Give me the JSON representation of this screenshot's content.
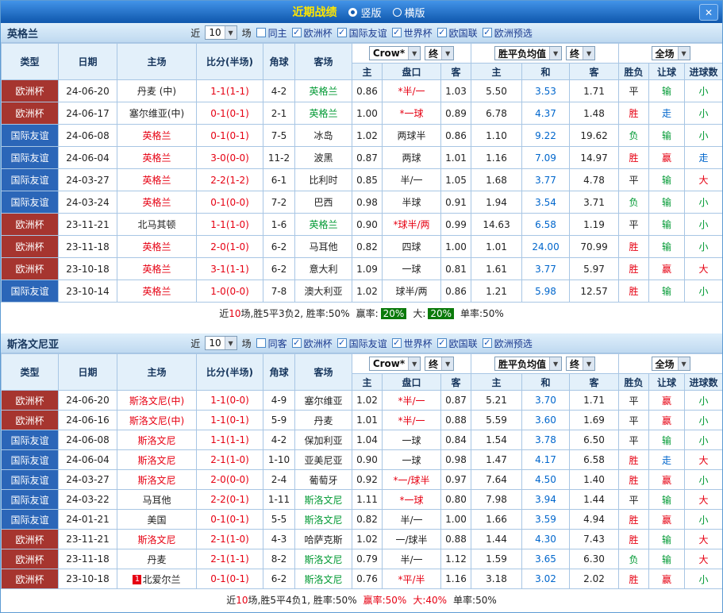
{
  "titlebar": {
    "title": "近期战绩",
    "radios": [
      {
        "label": "竖版",
        "selected": true
      },
      {
        "label": "横版",
        "selected": false
      }
    ]
  },
  "icons": {
    "close": "✕",
    "check": "✓",
    "chevron_down": "▼"
  },
  "colors": {
    "cup_bg": "#A6352F",
    "friendly_bg": "#2B66B8",
    "red_text": "#E60012",
    "green_text": "#009933",
    "blue_text": "#0066CC",
    "badge_green": "#0B7A0B"
  },
  "table_headers": {
    "left": [
      "类型",
      "日期",
      "主场",
      "比分(半场)",
      "角球",
      "客场"
    ],
    "sub": [
      "主",
      "盘口",
      "客",
      "主",
      "和",
      "客",
      "胜负",
      "让球",
      "进球数"
    ]
  },
  "sections": [
    {
      "team": "英格兰",
      "recent": {
        "pre": "近",
        "value": "10",
        "post": "场"
      },
      "checkboxes": [
        {
          "label": "同主",
          "checked": false
        },
        {
          "label": "欧洲杯",
          "checked": true
        },
        {
          "label": "国际友谊",
          "checked": true
        },
        {
          "label": "世界杯",
          "checked": true
        },
        {
          "label": "欧国联",
          "checked": true
        },
        {
          "label": "欧洲预选",
          "checked": true
        }
      ],
      "select_groups": [
        [
          "Crow*",
          "终"
        ],
        [
          "胜平负均值",
          "终"
        ],
        [
          "全场"
        ]
      ],
      "rows": [
        {
          "type": "欧洲杯",
          "date": "24-06-20",
          "home": "丹麦 (中)",
          "score": "1-1(1-1)",
          "corner": "4-2",
          "away": "英格兰",
          "hl": "away",
          "w1": "0.86",
          "hcp": "*半/一",
          "w2": "1.03",
          "e1": "5.50",
          "e2": "3.53",
          "e3": "1.71",
          "r1": "平",
          "r2": "输",
          "r3": "小"
        },
        {
          "type": "欧洲杯",
          "date": "24-06-17",
          "home": "塞尔维亚(中)",
          "score": "0-1(0-1)",
          "corner": "2-1",
          "away": "英格兰",
          "hl": "away",
          "w1": "1.00",
          "hcp": "*一球",
          "w2": "0.89",
          "e1": "6.78",
          "e2": "4.37",
          "e3": "1.48",
          "r1": "胜",
          "r2": "走",
          "r3": "小"
        },
        {
          "type": "国际友谊",
          "date": "24-06-08",
          "home": "英格兰",
          "score": "0-1(0-1)",
          "corner": "7-5",
          "away": "冰岛",
          "hl": "home",
          "w1": "1.02",
          "hcp": "两球半",
          "w2": "0.86",
          "e1": "1.10",
          "e2": "9.22",
          "e3": "19.62",
          "r1": "负",
          "r2": "输",
          "r3": "小"
        },
        {
          "type": "国际友谊",
          "date": "24-06-04",
          "home": "英格兰",
          "score": "3-0(0-0)",
          "corner": "11-2",
          "away": "波黑",
          "hl": "home",
          "w1": "0.87",
          "hcp": "两球",
          "w2": "1.01",
          "e1": "1.16",
          "e2": "7.09",
          "e3": "14.97",
          "r1": "胜",
          "r2": "赢",
          "r3": "走"
        },
        {
          "type": "国际友谊",
          "date": "24-03-27",
          "home": "英格兰",
          "score": "2-2(1-2)",
          "corner": "6-1",
          "away": "比利时",
          "hl": "home",
          "w1": "0.85",
          "hcp": "半/一",
          "w2": "1.05",
          "e1": "1.68",
          "e2": "3.77",
          "e3": "4.78",
          "r1": "平",
          "r2": "输",
          "r3": "大"
        },
        {
          "type": "国际友谊",
          "date": "24-03-24",
          "home": "英格兰",
          "score": "0-1(0-0)",
          "corner": "7-2",
          "away": "巴西",
          "hl": "home",
          "w1": "0.98",
          "hcp": "半球",
          "w2": "0.91",
          "e1": "1.94",
          "e2": "3.54",
          "e3": "3.71",
          "r1": "负",
          "r2": "输",
          "r3": "小"
        },
        {
          "type": "欧洲杯",
          "date": "23-11-21",
          "home": "北马其顿",
          "score": "1-1(1-0)",
          "corner": "1-6",
          "away": "英格兰",
          "hl": "away",
          "w1": "0.90",
          "hcp": "*球半/两",
          "w2": "0.99",
          "e1": "14.63",
          "e2": "6.58",
          "e3": "1.19",
          "r1": "平",
          "r2": "输",
          "r3": "小"
        },
        {
          "type": "欧洲杯",
          "date": "23-11-18",
          "home": "英格兰",
          "score": "2-0(1-0)",
          "corner": "6-2",
          "away": "马耳他",
          "hl": "home",
          "w1": "0.82",
          "hcp": "四球",
          "w2": "1.00",
          "e1": "1.01",
          "e2": "24.00",
          "e3": "70.99",
          "r1": "胜",
          "r2": "输",
          "r3": "小"
        },
        {
          "type": "欧洲杯",
          "date": "23-10-18",
          "home": "英格兰",
          "score": "3-1(1-1)",
          "corner": "6-2",
          "away": "意大利",
          "hl": "home",
          "w1": "1.09",
          "hcp": "一球",
          "w2": "0.81",
          "e1": "1.61",
          "e2": "3.77",
          "e3": "5.97",
          "r1": "胜",
          "r2": "赢",
          "r3": "大"
        },
        {
          "type": "国际友谊",
          "date": "23-10-14",
          "home": "英格兰",
          "score": "1-0(0-0)",
          "corner": "7-8",
          "away": "澳大利亚",
          "hl": "home",
          "w1": "1.02",
          "hcp": "球半/两",
          "w2": "0.86",
          "e1": "1.21",
          "e2": "5.98",
          "e3": "12.57",
          "r1": "胜",
          "r2": "输",
          "r3": "小"
        }
      ],
      "summary_runs": [
        {
          "t": "近"
        },
        {
          "t": "10",
          "s": "red"
        },
        {
          "t": "场,胜5平3负2, 胜率:50%"
        },
        {
          "t": "赢率:",
          "s": "sp"
        },
        {
          "t": "20%",
          "s": "badge"
        },
        {
          "t": "大:",
          "s": "sp"
        },
        {
          "t": "20%",
          "s": "badge"
        },
        {
          "t": "单率:50%",
          "s": "sp"
        }
      ]
    },
    {
      "team": "斯洛文尼亚",
      "recent": {
        "pre": "近",
        "value": "10",
        "post": "场"
      },
      "checkboxes": [
        {
          "label": "同客",
          "checked": false
        },
        {
          "label": "欧洲杯",
          "checked": true
        },
        {
          "label": "国际友谊",
          "checked": true
        },
        {
          "label": "世界杯",
          "checked": true
        },
        {
          "label": "欧国联",
          "checked": true
        },
        {
          "label": "欧洲预选",
          "checked": true
        }
      ],
      "select_groups": [
        [
          "Crow*",
          "终"
        ],
        [
          "胜平负均值",
          "终"
        ],
        [
          "全场"
        ]
      ],
      "rows": [
        {
          "type": "欧洲杯",
          "date": "24-06-20",
          "home": "斯洛文尼(中)",
          "score": "1-1(0-0)",
          "corner": "4-9",
          "away": "塞尔维亚",
          "hl": "home",
          "w1": "1.02",
          "hcp": "*半/一",
          "w2": "0.87",
          "e1": "5.21",
          "e2": "3.70",
          "e3": "1.71",
          "r1": "平",
          "r2": "赢",
          "r3": "小"
        },
        {
          "type": "欧洲杯",
          "date": "24-06-16",
          "home": "斯洛文尼(中)",
          "score": "1-1(0-1)",
          "corner": "5-9",
          "away": "丹麦",
          "hl": "home",
          "w1": "1.01",
          "hcp": "*半/一",
          "w2": "0.88",
          "e1": "5.59",
          "e2": "3.60",
          "e3": "1.69",
          "r1": "平",
          "r2": "赢",
          "r3": "小"
        },
        {
          "type": "国际友谊",
          "date": "24-06-08",
          "home": "斯洛文尼",
          "score": "1-1(1-1)",
          "corner": "4-2",
          "away": "保加利亚",
          "hl": "home",
          "w1": "1.04",
          "hcp": "一球",
          "w2": "0.84",
          "e1": "1.54",
          "e2": "3.78",
          "e3": "6.50",
          "r1": "平",
          "r2": "输",
          "r3": "小"
        },
        {
          "type": "国际友谊",
          "date": "24-06-04",
          "home": "斯洛文尼",
          "score": "2-1(1-0)",
          "corner": "1-10",
          "away": "亚美尼亚",
          "hl": "home",
          "w1": "0.90",
          "hcp": "一球",
          "w2": "0.98",
          "e1": "1.47",
          "e2": "4.17",
          "e3": "6.58",
          "r1": "胜",
          "r2": "走",
          "r3": "大"
        },
        {
          "type": "国际友谊",
          "date": "24-03-27",
          "home": "斯洛文尼",
          "score": "2-0(0-0)",
          "corner": "2-4",
          "away": "葡萄牙",
          "hl": "home",
          "w1": "0.92",
          "hcp": "*一/球半",
          "w2": "0.97",
          "e1": "7.64",
          "e2": "4.50",
          "e3": "1.40",
          "r1": "胜",
          "r2": "赢",
          "r3": "小"
        },
        {
          "type": "国际友谊",
          "date": "24-03-22",
          "home": "马耳他",
          "score": "2-2(0-1)",
          "corner": "1-11",
          "away": "斯洛文尼",
          "hl": "away",
          "w1": "1.11",
          "hcp": "*一球",
          "w2": "0.80",
          "e1": "7.98",
          "e2": "3.94",
          "e3": "1.44",
          "r1": "平",
          "r2": "输",
          "r3": "大"
        },
        {
          "type": "国际友谊",
          "date": "24-01-21",
          "home": "美国",
          "score": "0-1(0-1)",
          "corner": "5-5",
          "away": "斯洛文尼",
          "hl": "away",
          "w1": "0.82",
          "hcp": "半/一",
          "w2": "1.00",
          "e1": "1.66",
          "e2": "3.59",
          "e3": "4.94",
          "r1": "胜",
          "r2": "赢",
          "r3": "小"
        },
        {
          "type": "欧洲杯",
          "date": "23-11-21",
          "home": "斯洛文尼",
          "score": "2-1(1-0)",
          "corner": "4-3",
          "away": "哈萨克斯",
          "hl": "home",
          "w1": "1.02",
          "hcp": "一/球半",
          "w2": "0.88",
          "e1": "1.44",
          "e2": "4.30",
          "e3": "7.43",
          "r1": "胜",
          "r2": "输",
          "r3": "大"
        },
        {
          "type": "欧洲杯",
          "date": "23-11-18",
          "home": "丹麦",
          "score": "2-1(1-1)",
          "corner": "8-2",
          "away": "斯洛文尼",
          "hl": "away",
          "w1": "0.79",
          "hcp": "半/一",
          "w2": "1.12",
          "e1": "1.59",
          "e2": "3.65",
          "e3": "6.30",
          "r1": "负",
          "r2": "输",
          "r3": "大"
        },
        {
          "type": "欧洲杯",
          "date": "23-10-18",
          "home": "北爱尔兰",
          "home_badge": "1",
          "score": "0-1(0-1)",
          "corner": "6-2",
          "away": "斯洛文尼",
          "hl": "away",
          "w1": "0.76",
          "hcp": "*平/半",
          "w2": "1.16",
          "e1": "3.18",
          "e2": "3.02",
          "e3": "2.02",
          "r1": "胜",
          "r2": "赢",
          "r3": "小"
        }
      ],
      "summary_runs": [
        {
          "t": "近"
        },
        {
          "t": "10",
          "s": "red"
        },
        {
          "t": "场,胜5平4负1, 胜率:50%"
        },
        {
          "t": "赢率:50%",
          "s": "red sp"
        },
        {
          "t": "大:40%",
          "s": "red sp"
        },
        {
          "t": "单率:50%",
          "s": "sp"
        }
      ]
    }
  ]
}
